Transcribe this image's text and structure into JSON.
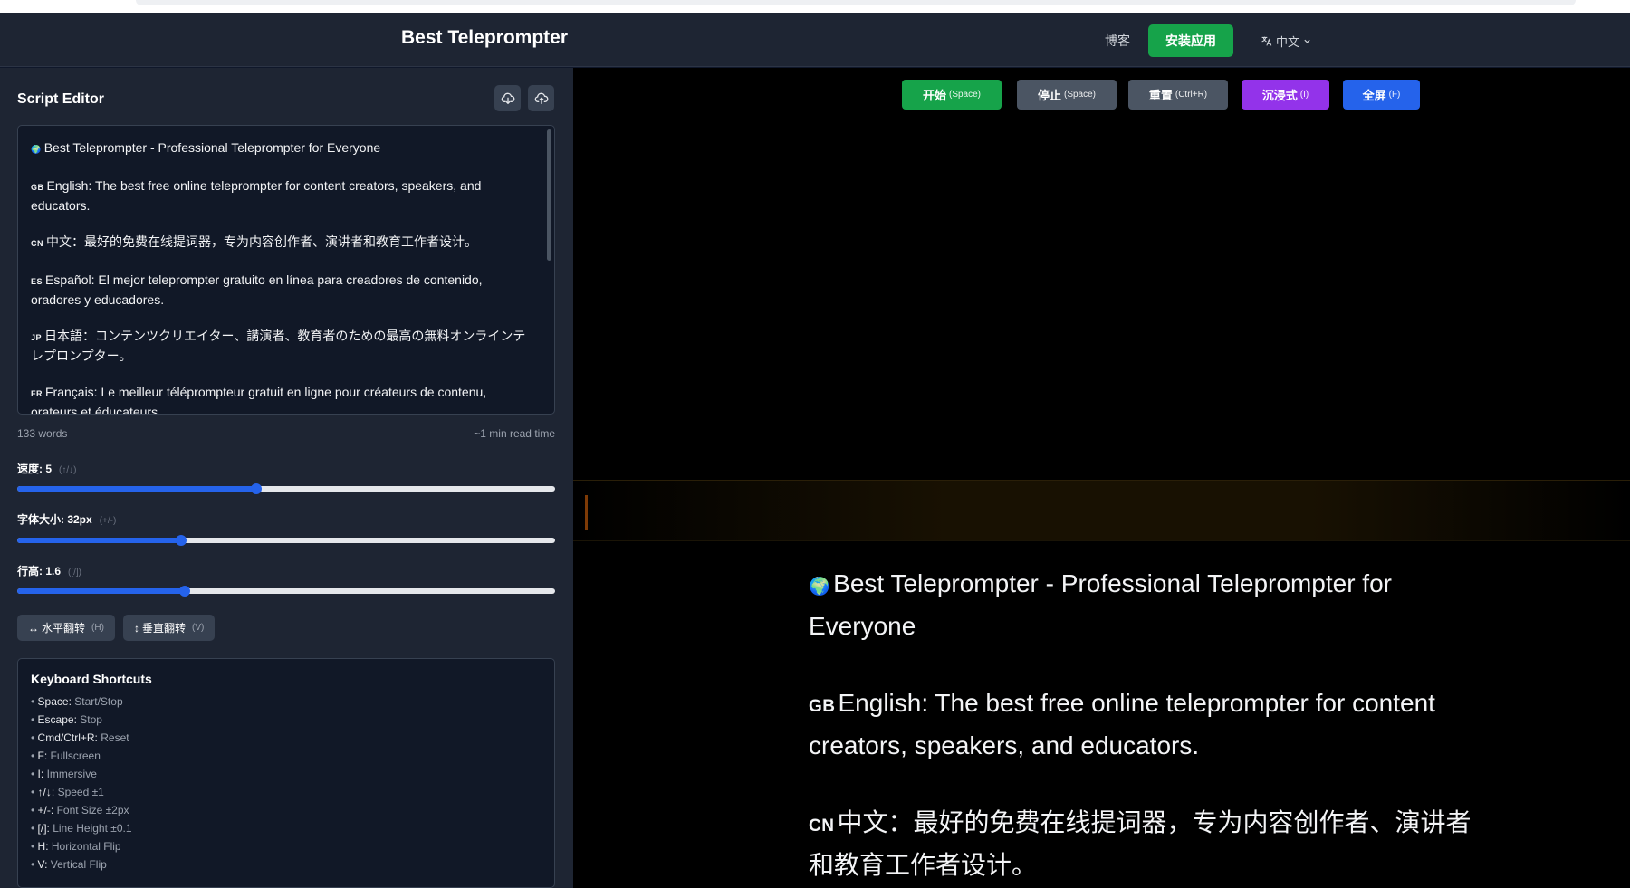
{
  "header": {
    "title": "Best Teleprompter",
    "nav_blog": "博客",
    "install_label": "安装应用",
    "language": "中文"
  },
  "sidebar": {
    "title": "Script Editor",
    "download_icon": "cloud-download-icon",
    "upload_icon": "cloud-upload-icon",
    "script": [
      {
        "flag": "🌍",
        "text": "Best Teleprompter - Professional Teleprompter for Everyone"
      },
      {
        "flag": "GB",
        "text": "English: The best free online teleprompter for content creators, speakers, and educators."
      },
      {
        "flag": "CN",
        "text": "中文：最好的免费在线提词器，专为内容创作者、演讲者和教育工作者设计。"
      },
      {
        "flag": "ES",
        "text": "Español: El mejor teleprompter gratuito en línea para creadores de contenido, oradores y educadores."
      },
      {
        "flag": "JP",
        "text": "日本語：コンテンツクリエイター、講演者、教育者のための最高の無料オンラインテレプロンプター。"
      },
      {
        "flag": "FR",
        "text": "Français: Le meilleur téléprompteur gratuit en ligne pour créateurs de contenu, orateurs et éducateurs."
      }
    ],
    "word_count": "133 words",
    "read_time": "~1 min read time",
    "sliders": {
      "speed": {
        "label": "速度: 5",
        "hint": "(↑/↓)",
        "value": 5,
        "min": 1,
        "max": 10,
        "fraction": 0.445
      },
      "font_size": {
        "label": "字体大小: 32px",
        "hint": "(+/-)",
        "value": 32,
        "fraction": 0.305
      },
      "line_height": {
        "label": "行高: 1.6",
        "hint": "([/])",
        "value": 1.6,
        "fraction": 0.312
      }
    },
    "flip_h": {
      "label": "水平翻转",
      "key": "(H)"
    },
    "flip_v": {
      "label": "垂直翻转",
      "key": "(V)"
    },
    "shortcuts": {
      "title": "Keyboard Shortcuts",
      "items": [
        {
          "key": "Space:",
          "desc": "Start/Stop"
        },
        {
          "key": "Escape:",
          "desc": "Stop"
        },
        {
          "key": "Cmd/Ctrl+R:",
          "desc": "Reset"
        },
        {
          "key": "F:",
          "desc": "Fullscreen"
        },
        {
          "key": "I:",
          "desc": "Immersive"
        },
        {
          "key": "↑/↓:",
          "desc": "Speed ±1"
        },
        {
          "key": "+/-:",
          "desc": "Font Size ±2px"
        },
        {
          "key": "[/]:",
          "desc": "Line Height ±0.1"
        },
        {
          "key": "H:",
          "desc": "Horizontal Flip"
        },
        {
          "key": "V:",
          "desc": "Vertical Flip"
        }
      ]
    }
  },
  "controls": [
    {
      "label": "开始",
      "key": "(Space)",
      "color": "#16a34a"
    },
    {
      "label": "停止",
      "key": "(Space)",
      "color": "#4b5563"
    },
    {
      "label": "重置",
      "key": "(Ctrl+R)",
      "color": "#4b5563"
    },
    {
      "label": "沉浸式",
      "key": "(I)",
      "color": "#9333ea"
    },
    {
      "label": "全屏",
      "key": "(F)",
      "color": "#2563eb"
    }
  ],
  "prompter": [
    {
      "flag": "🌍",
      "text": "Best Teleprompter - Professional Teleprompter for Everyone"
    },
    {
      "flag": "GB",
      "text": "English: The best free online teleprompter for content creators, speakers, and educators."
    },
    {
      "flag": "CN",
      "text": "中文：最好的免费在线提词器，专为内容创作者、演讲者和教育工作者设计。"
    }
  ]
}
